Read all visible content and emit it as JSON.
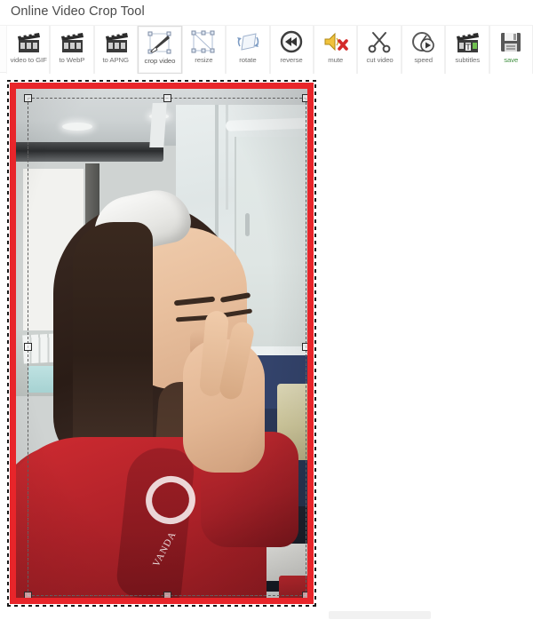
{
  "page": {
    "title": "Online Video Crop Tool"
  },
  "toolbar": {
    "items": [
      {
        "label": "video to GIF",
        "icon": "clapperboard-icon",
        "selected": false,
        "label_color": "default"
      },
      {
        "label": "to WebP",
        "icon": "clapperboard-icon",
        "selected": false,
        "label_color": "default"
      },
      {
        "label": "to APNG",
        "icon": "clapperboard-icon",
        "selected": false,
        "label_color": "default"
      },
      {
        "label": "crop video",
        "icon": "crop-icon",
        "selected": true,
        "label_color": "dark"
      },
      {
        "label": "resize",
        "icon": "resize-icon",
        "selected": false,
        "label_color": "default"
      },
      {
        "label": "rotate",
        "icon": "rotate-icon",
        "selected": false,
        "label_color": "default"
      },
      {
        "label": "reverse",
        "icon": "reverse-icon",
        "selected": false,
        "label_color": "default"
      },
      {
        "label": "mute",
        "icon": "mute-speaker-icon",
        "selected": false,
        "label_color": "default"
      },
      {
        "label": "cut video",
        "icon": "scissors-icon",
        "selected": false,
        "label_color": "default"
      },
      {
        "label": "speed",
        "icon": "speedometer-icon",
        "selected": false,
        "label_color": "default"
      },
      {
        "label": "subtitles",
        "icon": "subtitles-icon",
        "selected": false,
        "label_color": "default"
      },
      {
        "label": "save",
        "icon": "floppy-save-icon",
        "selected": false,
        "label_color": "green"
      }
    ]
  },
  "editor": {
    "video_border_color": "#e8252a",
    "selection_style": "marching-ants-dashed",
    "crop_handles": [
      "top-left",
      "top-center",
      "top-right",
      "middle-left",
      "middle-right",
      "bottom-left",
      "bottom-center",
      "bottom-right"
    ],
    "scene": {
      "description": "Young woman in red hoodie laughing with hand near face, indoor room with glass wall and air-conditioner",
      "hoodie_logo_text": "VANDA",
      "hoodie_logo_text2": "A"
    }
  }
}
